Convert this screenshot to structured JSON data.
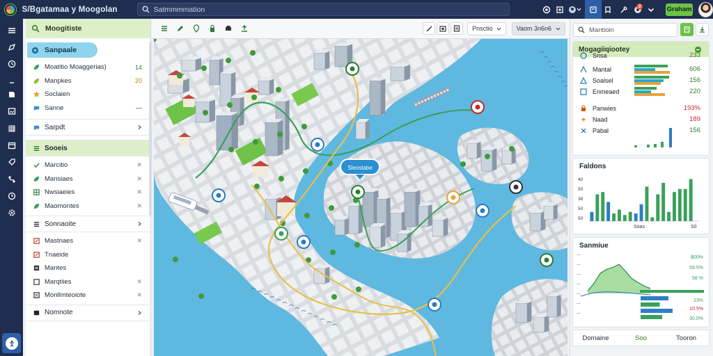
{
  "app": {
    "title": "S/Bgatamaa y Moogolan",
    "search_placeholder": "Satmmmmation",
    "cta_label": "Graham",
    "notification_count": "2"
  },
  "colors": {
    "topbar": "#1f2d4f",
    "accent_green": "#6dc247",
    "accent_blue": "#2f5fa8",
    "water": "#5fb8e0",
    "panel_header": "#dcefc8"
  },
  "left_panel": {
    "header": "Moogitiste",
    "active_pill": "Sanpaale",
    "group1": [
      {
        "label": "Moatitio Moaggerias)",
        "value": "14",
        "icon": "leaf-icon"
      },
      {
        "label": "Manpkes",
        "value": "20",
        "icon": "leaf-icon"
      },
      {
        "label": "Soclaien",
        "value": "",
        "icon": "star-icon"
      },
      {
        "label": "Sanne",
        "value": "—",
        "icon": "chat-icon"
      }
    ],
    "sarpdt": "Sarpdt",
    "section2_header": "Sooeis",
    "group2": [
      {
        "label": "Marcitio",
        "icon": "check-icon"
      },
      {
        "label": "Mansiaes",
        "icon": "leaf-icon"
      },
      {
        "label": "Nwsiaeies",
        "icon": "grid-icon"
      },
      {
        "label": "Maomontes",
        "icon": "leaf-icon"
      }
    ],
    "section3_header": "Sonnaoite",
    "group3": [
      {
        "label": "Mastnaes",
        "icon": "edit-icon"
      },
      {
        "label": "Tnaeide",
        "icon": "edit-icon"
      },
      {
        "label": "Mantes",
        "icon": "list-icon"
      },
      {
        "label": "Marqtiies",
        "icon": "square-icon"
      },
      {
        "label": "Monllmteoiote",
        "icon": "list-icon"
      }
    ],
    "footer_item": "Nomnote"
  },
  "map_toolbar": {
    "select1": "Pnsctio",
    "select2": "Vaom 3n6n6"
  },
  "map": {
    "label": "Sleostabe"
  },
  "right_panel": {
    "search_placeholder": "Mantioin",
    "card1_title": "Mogagiiqiootey",
    "metrics": [
      {
        "label": "Snsa",
        "value": "233",
        "color": "#2e7d32",
        "icon": "circle-icon",
        "bars": [
          0.0,
          0.0,
          0.0
        ]
      },
      {
        "label": "Mantal",
        "value": "606",
        "color": "#2e7d32",
        "icon": "arrow-icon",
        "bars": [
          0.88,
          0.55,
          0.95
        ]
      },
      {
        "label": "Soalsel",
        "value": "156",
        "color": "#2e7d32",
        "icon": "triangle-icon",
        "bars": [
          0.92,
          0.78,
          0.7
        ]
      },
      {
        "label": "Enmeaed",
        "value": "220",
        "color": "#2e7d32",
        "icon": "image-icon",
        "bars": [
          0.6,
          0.45,
          0.82
        ]
      },
      {
        "label": "Panwies",
        "value": "193%",
        "color": "#c62828",
        "icon": "lock-icon",
        "bars": [
          0,
          0,
          0
        ]
      },
      {
        "label": "Naad",
        "value": "189",
        "color": "#c62828",
        "icon": "bolt-icon",
        "bars": [
          0,
          0,
          0
        ]
      },
      {
        "label": "Pabal",
        "value": "156",
        "color": "#2e7d32",
        "icon": "x-icon",
        "bars": [
          0,
          0,
          0
        ]
      }
    ],
    "card2_title": "Faldons",
    "card3_title": "Sanmiue",
    "tabs": [
      "Domaine",
      "Soo",
      "Tooron"
    ]
  },
  "chart_data": [
    {
      "type": "bar",
      "title": "Faldons",
      "categories": [
        "1",
        "2",
        "3",
        "4",
        "5",
        "6",
        "7",
        "8",
        "9",
        "10",
        "11",
        "12",
        "13",
        "14",
        "15",
        "16",
        "17",
        "18",
        "19",
        "20"
      ],
      "series": [
        {
          "values": [
            0,
            35,
            38,
            0,
            10,
            15,
            8,
            12,
            0,
            0,
            45,
            5,
            35,
            50,
            12,
            38,
            42,
            42,
            55,
            0
          ],
          "color": "#3aa05a"
        },
        {
          "values": [
            12,
            0,
            0,
            25,
            0,
            0,
            0,
            0,
            10,
            22,
            0,
            0,
            0,
            0,
            0,
            0,
            0,
            0,
            0,
            0
          ],
          "color": "#2e7bc4"
        }
      ],
      "ylim": [
        0,
        60
      ],
      "x_tick_labels": [
        "Soas",
        "S0"
      ],
      "y_tick_labels": [
        "40",
        "50",
        "38",
        "50",
        "50"
      ]
    },
    {
      "type": "area",
      "title": "Sanmiue",
      "x": [
        0,
        0.1,
        0.2,
        0.3,
        0.4,
        0.5,
        0.6,
        0.7,
        0.8,
        0.9,
        1.0
      ],
      "values": [
        5,
        20,
        40,
        48,
        52,
        58,
        45,
        30,
        22,
        15,
        10
      ],
      "ylim": [
        0,
        80
      ],
      "percent_labels": [
        "$00%",
        "59.5%",
        "58 %",
        "13%",
        "10.5%",
        "30.0%"
      ],
      "bars": [
        {
          "label": "13%",
          "value": 0.8,
          "color": "#2f7fc7"
        },
        {
          "label": "10.5%",
          "value": 0.55,
          "color": "#3aa05a"
        },
        {
          "label": "30.0%",
          "value": 0.92,
          "color": "#2f7fc7"
        },
        {
          "label": "",
          "value": 0.62,
          "color": "#3aa05a"
        }
      ]
    }
  ]
}
